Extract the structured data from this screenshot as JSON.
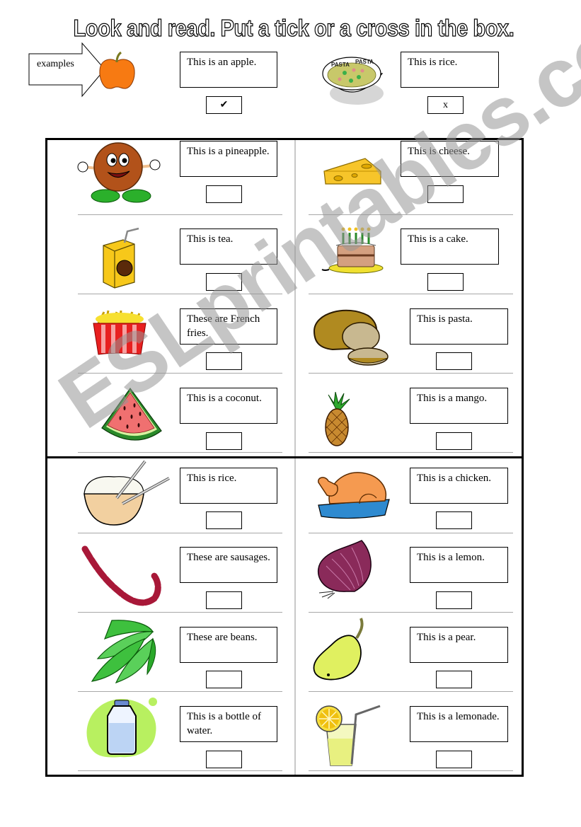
{
  "title": "Look and read. Put a tick or a cross in the box.",
  "examples": {
    "arrow_label": "examples",
    "items": [
      {
        "picture": "apple",
        "sentence": "This is an apple.",
        "answer": "✔"
      },
      {
        "picture": "pasta-bowl",
        "sentence": "This is rice.",
        "answer": "x"
      }
    ]
  },
  "exercises": [
    {
      "picture": "coconut-character",
      "sentence": "This is a pineapple.",
      "answer": ""
    },
    {
      "picture": "cheese",
      "sentence": "This is cheese.",
      "answer": ""
    },
    {
      "picture": "juice-box",
      "sentence": "This is tea.",
      "answer": ""
    },
    {
      "picture": "birthday-cake",
      "sentence": "This is a cake.",
      "answer": ""
    },
    {
      "picture": "french-fries",
      "sentence": "These are French fries.",
      "answer": ""
    },
    {
      "picture": "bread",
      "sentence": "This is pasta.",
      "answer": ""
    },
    {
      "picture": "watermelon",
      "sentence": "This is a coconut.",
      "answer": ""
    },
    {
      "picture": "pineapple",
      "sentence": "This is a mango.",
      "answer": ""
    },
    {
      "picture": "rice-bowl",
      "sentence": "This is rice.",
      "answer": ""
    },
    {
      "picture": "roast-chicken",
      "sentence": "This is a chicken.",
      "answer": ""
    },
    {
      "picture": "sausages",
      "sentence": "These are sausages.",
      "answer": ""
    },
    {
      "picture": "onion",
      "sentence": "This is a lemon.",
      "answer": ""
    },
    {
      "picture": "pea-pods",
      "sentence": "These are beans.",
      "answer": ""
    },
    {
      "picture": "pear",
      "sentence": "This is a pear.",
      "answer": ""
    },
    {
      "picture": "water-bottle",
      "sentence": "This is a bottle of water.",
      "answer": ""
    },
    {
      "picture": "lemonade-glass",
      "sentence": "This is a lemonade.",
      "answer": ""
    }
  ],
  "watermark": "ESLprintables.com"
}
